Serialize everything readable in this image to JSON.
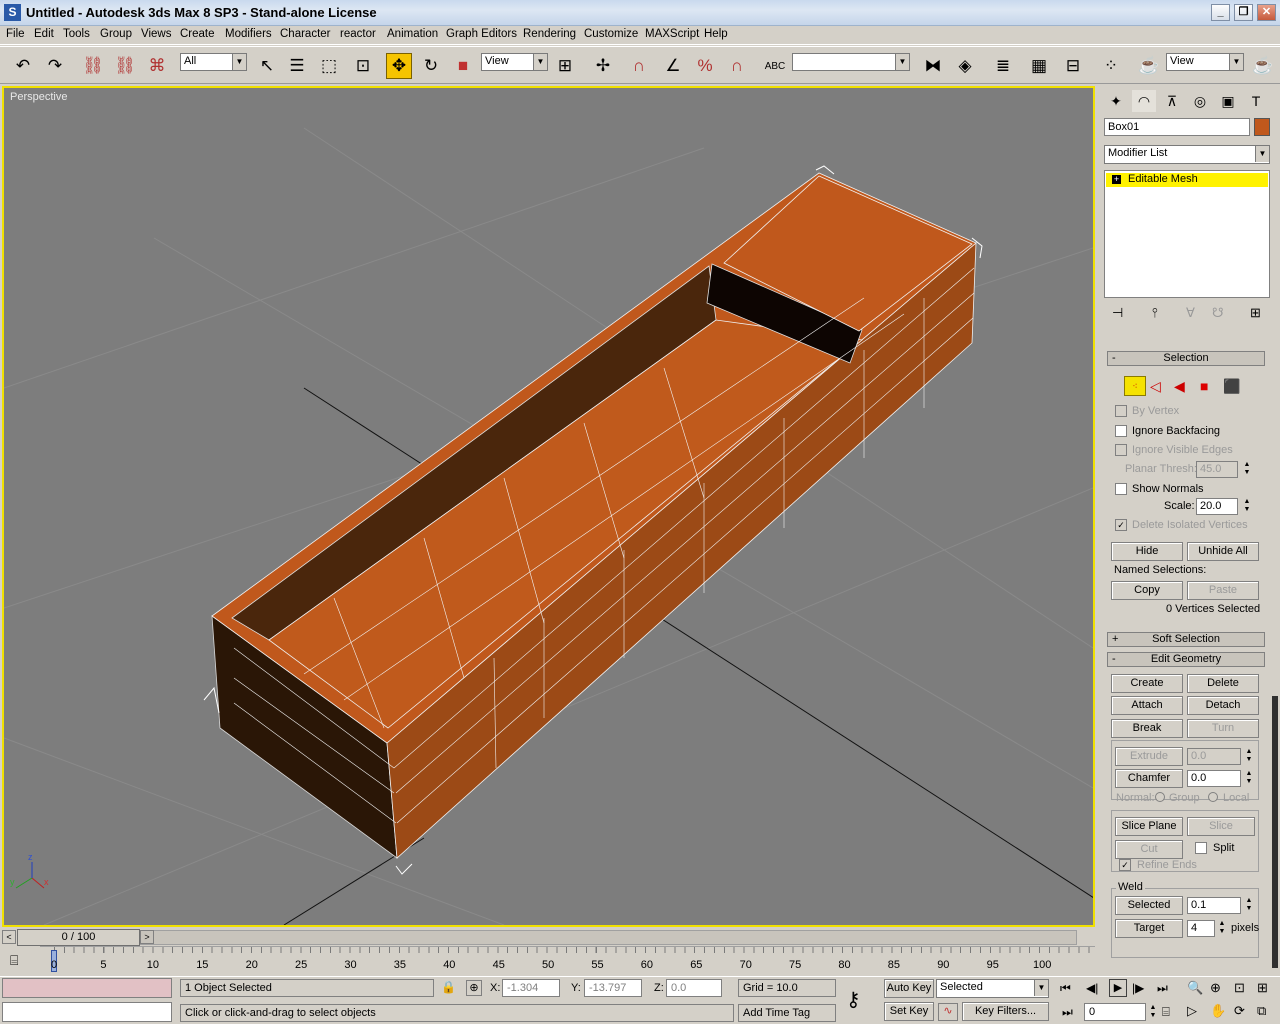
{
  "window": {
    "title": "Untitled - Autodesk 3ds Max 8 SP3   - Stand-alone License",
    "minimize": "_",
    "restore": "❐",
    "close": "✕"
  },
  "menu": [
    "File",
    "Edit",
    "Tools",
    "Group",
    "Views",
    "Create",
    "Modifiers",
    "Character",
    "reactor",
    "Animation",
    "Graph Editors",
    "Rendering",
    "Customize",
    "MAXScript",
    "Help"
  ],
  "toolbar": {
    "filter_value": "All",
    "refcoord_value": "View",
    "named_sel_value": "",
    "render_type_value": "View"
  },
  "viewport": {
    "label": "Perspective",
    "axis": {
      "x": "x",
      "y": "y",
      "z": "z"
    }
  },
  "command_panel": {
    "object_name": "Box01",
    "object_color": "#c0581c",
    "modifier_list": "Modifier List",
    "stack_item": "Editable Mesh",
    "selection": {
      "header": "Selection",
      "by_vertex": "By Vertex",
      "ignore_backfacing": "Ignore Backfacing",
      "ignore_visible_edges": "Ignore Visible Edges",
      "planar_thresh_label": "Planar Thresh:",
      "planar_thresh_value": "45.0",
      "show_normals": "Show Normals",
      "scale_label": "Scale:",
      "scale_value": "20.0",
      "delete_isolated": "Delete Isolated Vertices",
      "hide": "Hide",
      "unhide_all": "Unhide All",
      "named_selections": "Named Selections:",
      "copy": "Copy",
      "paste": "Paste",
      "status": "0 Vertices Selected"
    },
    "soft_selection": "Soft Selection",
    "edit_geometry": {
      "header": "Edit Geometry",
      "create": "Create",
      "delete": "Delete",
      "attach": "Attach",
      "detach": "Detach",
      "break": "Break",
      "turn": "Turn",
      "extrude": "Extrude",
      "extrude_value": "0.0",
      "chamfer": "Chamfer",
      "chamfer_value": "0.0",
      "normal_label": "Normal:",
      "group": "Group",
      "local": "Local",
      "slice_plane": "Slice Plane",
      "slice": "Slice",
      "cut": "Cut",
      "split": "Split",
      "refine_ends": "Refine Ends",
      "weld_label": "Weld",
      "selected": "Selected",
      "selected_value": "0.1",
      "target": "Target",
      "target_value": "4",
      "pixels": "pixels"
    }
  },
  "timeline": {
    "frame_label": "0 / 100",
    "ticks": [
      "0",
      "5",
      "10",
      "15",
      "20",
      "25",
      "30",
      "35",
      "40",
      "45",
      "50",
      "55",
      "60",
      "65",
      "70",
      "75",
      "80",
      "85",
      "90",
      "95",
      "100"
    ]
  },
  "status": {
    "objects_selected": "1 Object Selected",
    "prompt": "Click or click-and-drag to select objects",
    "x_label": "X:",
    "x_value": "-1.304",
    "y_label": "Y:",
    "y_value": "-13.797",
    "z_label": "Z:",
    "z_value": "0.0",
    "grid": "Grid = 10.0",
    "add_time_tag": "Add Time Tag",
    "auto_key": "Auto Key",
    "set_key": "Set Key",
    "key_mode_value": "Selected",
    "key_filters": "Key Filters...",
    "current_frame": "0"
  }
}
